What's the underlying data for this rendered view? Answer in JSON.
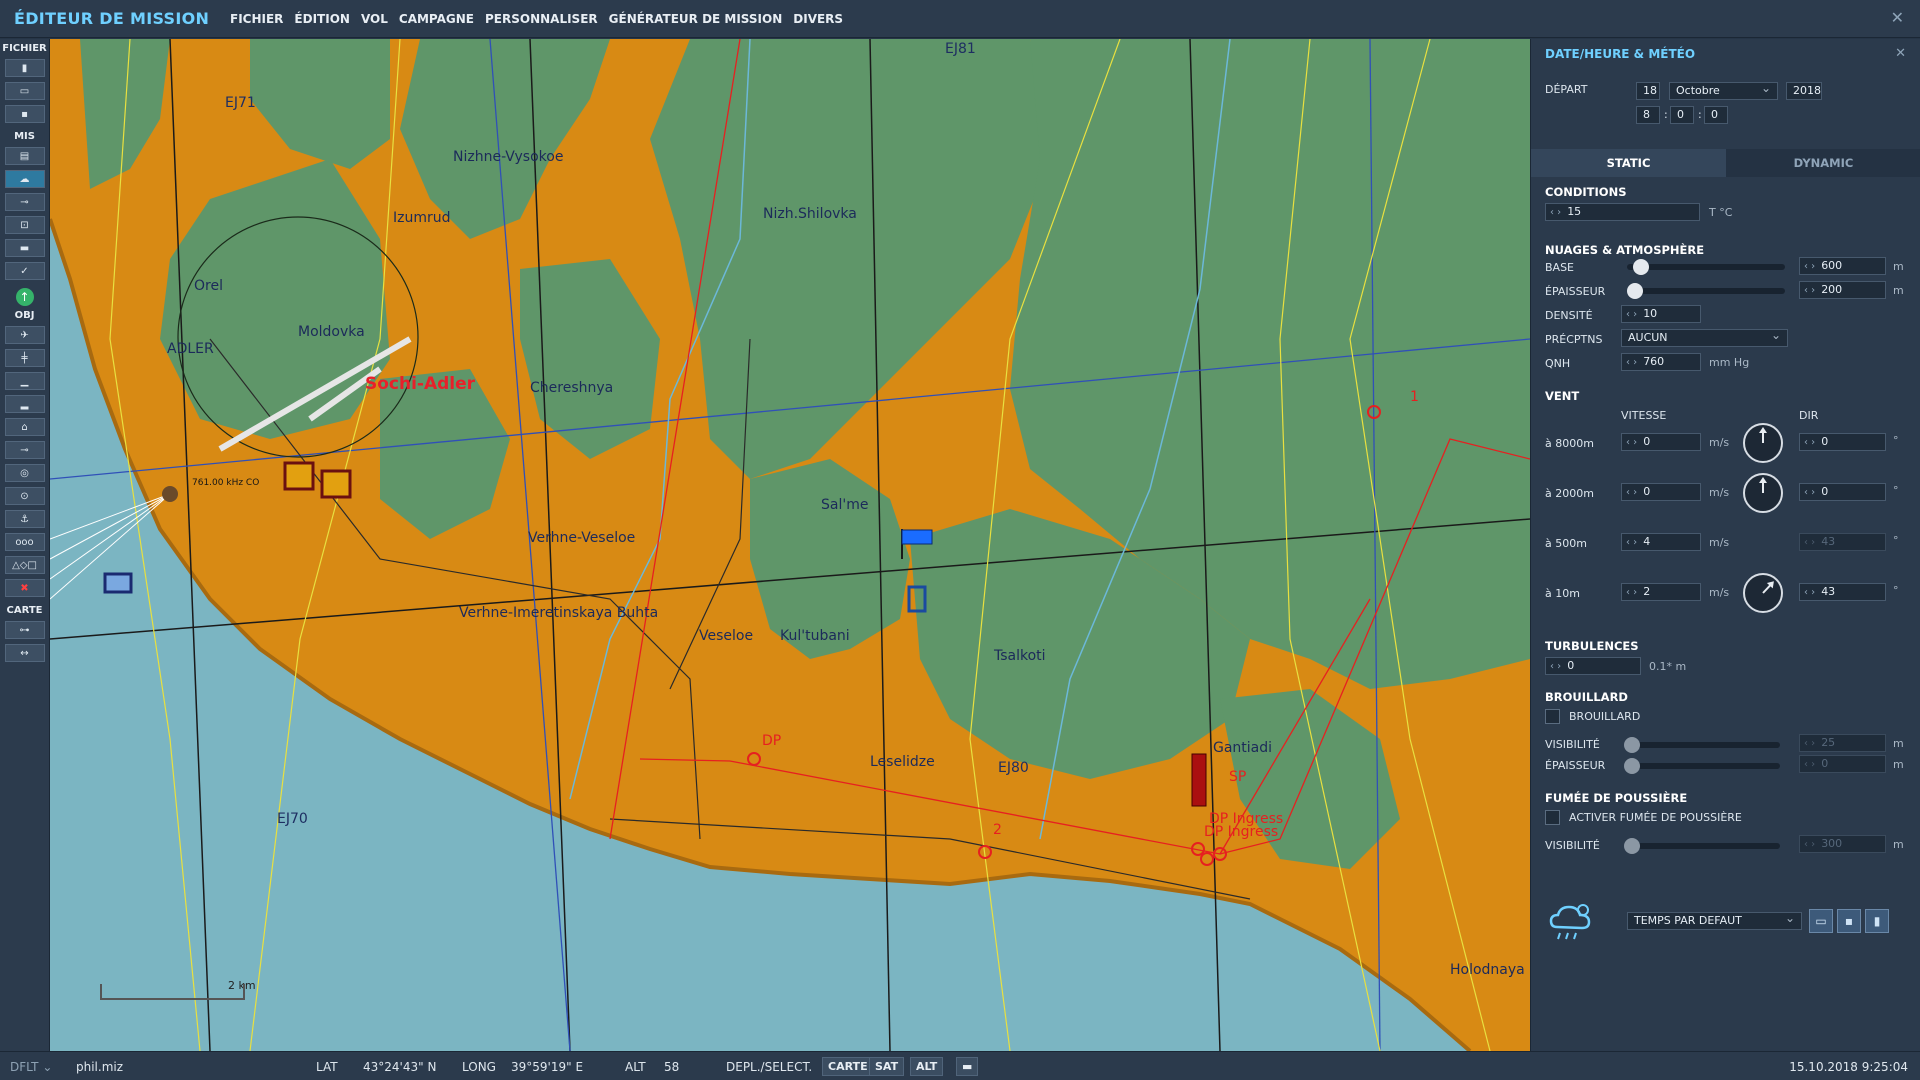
{
  "app": {
    "title": "ÉDITEUR DE MISSION",
    "menu": [
      "FICHIER",
      "ÉDITION",
      "VOL",
      "CAMPAGNE",
      "PERSONNALISER",
      "GÉNÉRATEUR DE MISSION",
      "DIVERS"
    ],
    "close_glyph": "✕"
  },
  "toolbar": {
    "sections": {
      "fichier": "FICHIER",
      "mis": "MIS",
      "obj": "OBJ",
      "carte": "CARTE"
    },
    "icons": {
      "fichier": [
        "new-file-icon",
        "open-folder-icon",
        "save-icon"
      ],
      "mis": [
        "mission-goals-icon",
        "weather-icon",
        "flight-path-icon",
        "triggers-icon",
        "briefing-icon",
        "checkmark-icon"
      ],
      "obj": [
        "aircraft-icon",
        "helicopter-icon",
        "ship-icon",
        "ground-unit-icon",
        "static-object-icon",
        "waypoint-icon",
        "target-zone-icon",
        "circle-zone-icon",
        "carrier-icon",
        "formation-icon",
        "shapes-icon",
        "delete-icon"
      ],
      "carte": [
        "map-options-icon",
        "ruler-icon"
      ]
    }
  },
  "map": {
    "labels": [
      {
        "text": "EJ71",
        "kind": "zone"
      },
      {
        "text": "EJ81",
        "kind": "zone"
      },
      {
        "text": "Nizhne-Vysokoe",
        "kind": "town"
      },
      {
        "text": "Izumrud",
        "kind": "town"
      },
      {
        "text": "Nizh.Shilovka",
        "kind": "town"
      },
      {
        "text": "Orel",
        "kind": "town"
      },
      {
        "text": "Moldovka",
        "kind": "town"
      },
      {
        "text": "ADLER",
        "kind": "town"
      },
      {
        "text": "Chereshnya",
        "kind": "town"
      },
      {
        "text": "Sal'me",
        "kind": "town"
      },
      {
        "text": "Verhne-Veseloe",
        "kind": "town"
      },
      {
        "text": "Verhne-Imeretinskaya Buhta",
        "kind": "town"
      },
      {
        "text": "Veseloe",
        "kind": "town"
      },
      {
        "text": "Kul'tubani",
        "kind": "town"
      },
      {
        "text": "Tsalkoti",
        "kind": "town"
      },
      {
        "text": "Leselidze",
        "kind": "town"
      },
      {
        "text": "EJ80",
        "kind": "zone"
      },
      {
        "text": "Gantiadi",
        "kind": "town"
      },
      {
        "text": "EJ70",
        "kind": "zone"
      },
      {
        "text": "Holodnaya",
        "kind": "town"
      }
    ],
    "airport": "Sochi-Adler",
    "beacon": "761.00 kHz CO",
    "waypoints": {
      "wp1": "1",
      "wp2": "2",
      "dp": "DP",
      "sp": "SP",
      "ingress1": "DP Ingress",
      "ingress2": "DP Ingress"
    },
    "scale": "2 km",
    "colors": {
      "sea": "#7bb5c2",
      "land": "#d88a14",
      "forest": "#5f9669"
    }
  },
  "panel": {
    "title": "DATE/HEURE & MÉTÉO",
    "close_glyph": "✕",
    "depart": {
      "label": "DÉPART",
      "day": "18",
      "month": "Octobre",
      "year": "2018",
      "hour": "8",
      "minute": "0",
      "second": "0",
      "sep": ":"
    },
    "tabs": {
      "static": "STATIC",
      "dynamic": "DYNAMIC"
    },
    "conditions": {
      "title": "CONDITIONS",
      "temp": "15",
      "temp_unit": "T °C"
    },
    "clouds": {
      "title": "NUAGES & ATMOSPHÈRE",
      "base_label": "BASE",
      "base": "600",
      "base_unit": "m",
      "base_level": 0.04,
      "thickness_label": "ÉPAISSEUR",
      "thickness": "200",
      "thickness_unit": "m",
      "thickness_level": 0.0,
      "density_label": "DENSITÉ",
      "density": "10",
      "precip_label": "PRÉCPTNS",
      "precip": "AUCUN",
      "qnh_label": "QNH",
      "qnh": "760",
      "qnh_unit": "mm Hg"
    },
    "wind": {
      "title": "VENT",
      "speed_header": "VITESSE",
      "dir_header": "DIR",
      "rows": [
        {
          "alt": "à 8000m",
          "speed": "0",
          "unit": "m/s",
          "dir": "0",
          "deg": "°",
          "angle": 0
        },
        {
          "alt": "à 2000m",
          "speed": "0",
          "unit": "m/s",
          "dir": "0",
          "deg": "°",
          "angle": 0
        },
        {
          "alt": "à 500m",
          "speed": "4",
          "unit": "m/s",
          "dir": "43",
          "deg": "°",
          "angle": 43
        },
        {
          "alt": "à 10m",
          "speed": "2",
          "unit": "m/s",
          "dir": "43",
          "deg": "°",
          "angle": 43
        }
      ]
    },
    "turbulence": {
      "title": "TURBULENCES",
      "value": "0",
      "unit": "0.1* m"
    },
    "fog": {
      "title": "BROUILLARD",
      "checkbox_label": "BROUILLARD",
      "visibility_label": "VISIBILITÉ",
      "visibility": "25",
      "visibility_unit": "m",
      "thickness_label": "ÉPAISSEUR",
      "thickness": "0",
      "thickness_unit": "m"
    },
    "dust": {
      "title": "FUMÉE DE POUSSIÈRE",
      "checkbox_label": "ACTIVER FUMÉE DE POUSSIÈRE",
      "visibility_label": "VISIBILITÉ",
      "visibility": "300",
      "visibility_unit": "m"
    },
    "preset": {
      "value": "TEMPS PAR DEFAUT"
    },
    "file_buttons": [
      "open-folder-icon",
      "save-icon",
      "delete-icon"
    ]
  },
  "status": {
    "profile": "DFLT",
    "file": "phil.miz",
    "lat_label": "LAT",
    "lat": "43°24'43\" N",
    "long_label": "LONG",
    "long": "39°59'19\" E",
    "alt_label": "ALT",
    "alt": "58",
    "mode_label": "DEPL./SELECT.",
    "buttons": [
      "CARTE",
      "SAT",
      "ALT"
    ],
    "datetime": "15.10.2018 9:25:04"
  }
}
